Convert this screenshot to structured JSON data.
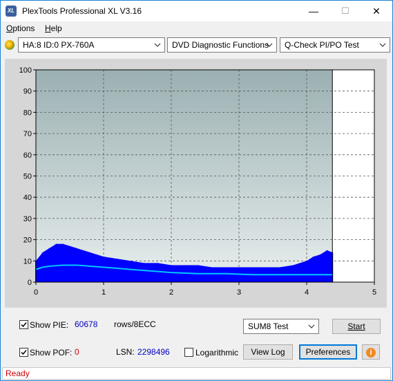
{
  "window": {
    "title": "PlexTools Professional XL V3.16",
    "icon_text": "XL"
  },
  "controls": {
    "minimize": "—",
    "maximize": "☐",
    "close": "✕"
  },
  "menu": [
    {
      "label": "Options",
      "accel": "O",
      "rest": "ptions"
    },
    {
      "label": "Help",
      "accel": "H",
      "rest": "elp"
    }
  ],
  "toolbar": {
    "drive": "HA:8 ID:0  PX-760A",
    "function": "DVD Diagnostic Functions",
    "test": "Q-Check PI/PO Test"
  },
  "chart_data": {
    "type": "area",
    "ylim": [
      0,
      100
    ],
    "xlim": [
      0,
      5
    ],
    "y_ticks": [
      "100",
      "90",
      "80",
      "70",
      "60",
      "50",
      "40",
      "30",
      "20",
      "10",
      "0"
    ],
    "x_ticks": [
      "0",
      "1",
      "2",
      "3",
      "4",
      "5"
    ],
    "grid": true,
    "scan_end_x": 4.38,
    "series": [
      {
        "kind": "bars",
        "color": "#0000ff",
        "x": [
          0.0,
          0.1,
          0.2,
          0.3,
          0.4,
          0.5,
          0.6,
          0.7,
          0.8,
          0.9,
          1.0,
          1.2,
          1.4,
          1.6,
          1.8,
          2.0,
          2.2,
          2.4,
          2.6,
          2.8,
          3.0,
          3.2,
          3.4,
          3.6,
          3.8,
          4.0,
          4.1,
          4.2,
          4.3,
          4.38
        ],
        "values": [
          10,
          14,
          16,
          18,
          18,
          17,
          16,
          15,
          14,
          13,
          12,
          11,
          10,
          9,
          9,
          8,
          8,
          8,
          7,
          7,
          7,
          7,
          7,
          7,
          8,
          10,
          12,
          13,
          15,
          14
        ]
      },
      {
        "kind": "line",
        "color": "#00c8ff",
        "x": [
          0.0,
          0.1,
          0.2,
          0.4,
          0.6,
          0.8,
          1.0,
          1.2,
          1.4,
          1.6,
          1.8,
          2.0,
          2.4,
          2.8,
          3.2,
          3.6,
          4.0,
          4.38
        ],
        "values": [
          6,
          7,
          7.5,
          8,
          8,
          7.5,
          7,
          6.5,
          6,
          5.5,
          5,
          4.5,
          4,
          4,
          3.5,
          3.5,
          3.5,
          3.5
        ]
      }
    ]
  },
  "bottom": {
    "show_pie_label": "Show PIE:",
    "pie_value": "60678",
    "rows_label": "rows/8ECC",
    "show_pof_label": "Show POF:",
    "pof_value": "0",
    "lsn_label": "LSN:",
    "lsn_value": "2298496",
    "log_label": "Logarithmic",
    "sum_test": "SUM8 Test",
    "start": "Start",
    "view_log": "View Log",
    "preferences": "Preferences",
    "info_icon_glyph": "i"
  },
  "status": {
    "text": "Ready"
  }
}
